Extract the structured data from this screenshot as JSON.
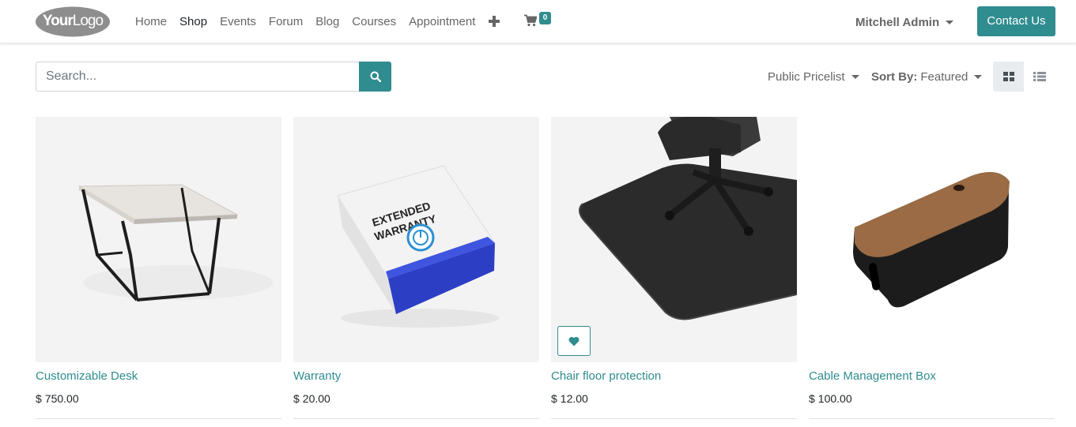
{
  "header": {
    "logo": {
      "text_bold": "Your",
      "text_light": "Logo"
    },
    "nav": [
      {
        "label": "Home",
        "active": false
      },
      {
        "label": "Shop",
        "active": true
      },
      {
        "label": "Events",
        "active": false
      },
      {
        "label": "Forum",
        "active": false
      },
      {
        "label": "Blog",
        "active": false
      },
      {
        "label": "Courses",
        "active": false
      },
      {
        "label": "Appointment",
        "active": false
      }
    ],
    "plus_icon": "plus-icon",
    "cart": {
      "icon": "shopping-cart-icon",
      "count": "0"
    },
    "user_name": "Mitchell Admin",
    "contact_label": "Contact Us"
  },
  "toolbar": {
    "search_placeholder": "Search...",
    "search_icon": "search-icon",
    "pricelist_label": "Public Pricelist",
    "sort_label": "Sort By:",
    "sort_value": "Featured",
    "view_modes": [
      "grid-view-icon",
      "list-view-icon"
    ],
    "active_view": "grid"
  },
  "products": [
    {
      "name": "Customizable Desk",
      "currency": "$",
      "price": "750.00",
      "image": "desk",
      "wishlist": false
    },
    {
      "name": "Warranty",
      "currency": "$",
      "price": "20.00",
      "image": "warranty-box",
      "box_text_1": "EXTENDED",
      "box_text_2": "WARRANTY",
      "wishlist": false
    },
    {
      "name": "Chair floor protection",
      "currency": "$",
      "price": "12.00",
      "image": "chair-floor-mat",
      "wishlist": true
    },
    {
      "name": "Cable Management Box",
      "currency": "$",
      "price": "100.00",
      "image": "cable-box",
      "wishlist": false
    }
  ],
  "colors": {
    "accent": "#2f8c8f",
    "nav_text": "#666666",
    "border": "#dee2e6"
  }
}
